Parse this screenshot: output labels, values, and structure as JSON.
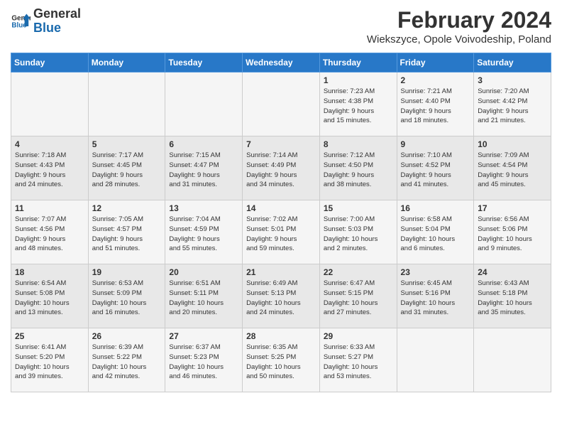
{
  "logo": {
    "general": "General",
    "blue": "Blue"
  },
  "title": "February 2024",
  "subtitle": "Wiekszyce, Opole Voivodeship, Poland",
  "days_of_week": [
    "Sunday",
    "Monday",
    "Tuesday",
    "Wednesday",
    "Thursday",
    "Friday",
    "Saturday"
  ],
  "weeks": [
    [
      {
        "day": "",
        "info": ""
      },
      {
        "day": "",
        "info": ""
      },
      {
        "day": "",
        "info": ""
      },
      {
        "day": "",
        "info": ""
      },
      {
        "day": "1",
        "info": "Sunrise: 7:23 AM\nSunset: 4:38 PM\nDaylight: 9 hours\nand 15 minutes."
      },
      {
        "day": "2",
        "info": "Sunrise: 7:21 AM\nSunset: 4:40 PM\nDaylight: 9 hours\nand 18 minutes."
      },
      {
        "day": "3",
        "info": "Sunrise: 7:20 AM\nSunset: 4:42 PM\nDaylight: 9 hours\nand 21 minutes."
      }
    ],
    [
      {
        "day": "4",
        "info": "Sunrise: 7:18 AM\nSunset: 4:43 PM\nDaylight: 9 hours\nand 24 minutes."
      },
      {
        "day": "5",
        "info": "Sunrise: 7:17 AM\nSunset: 4:45 PM\nDaylight: 9 hours\nand 28 minutes."
      },
      {
        "day": "6",
        "info": "Sunrise: 7:15 AM\nSunset: 4:47 PM\nDaylight: 9 hours\nand 31 minutes."
      },
      {
        "day": "7",
        "info": "Sunrise: 7:14 AM\nSunset: 4:49 PM\nDaylight: 9 hours\nand 34 minutes."
      },
      {
        "day": "8",
        "info": "Sunrise: 7:12 AM\nSunset: 4:50 PM\nDaylight: 9 hours\nand 38 minutes."
      },
      {
        "day": "9",
        "info": "Sunrise: 7:10 AM\nSunset: 4:52 PM\nDaylight: 9 hours\nand 41 minutes."
      },
      {
        "day": "10",
        "info": "Sunrise: 7:09 AM\nSunset: 4:54 PM\nDaylight: 9 hours\nand 45 minutes."
      }
    ],
    [
      {
        "day": "11",
        "info": "Sunrise: 7:07 AM\nSunset: 4:56 PM\nDaylight: 9 hours\nand 48 minutes."
      },
      {
        "day": "12",
        "info": "Sunrise: 7:05 AM\nSunset: 4:57 PM\nDaylight: 9 hours\nand 51 minutes."
      },
      {
        "day": "13",
        "info": "Sunrise: 7:04 AM\nSunset: 4:59 PM\nDaylight: 9 hours\nand 55 minutes."
      },
      {
        "day": "14",
        "info": "Sunrise: 7:02 AM\nSunset: 5:01 PM\nDaylight: 9 hours\nand 59 minutes."
      },
      {
        "day": "15",
        "info": "Sunrise: 7:00 AM\nSunset: 5:03 PM\nDaylight: 10 hours\nand 2 minutes."
      },
      {
        "day": "16",
        "info": "Sunrise: 6:58 AM\nSunset: 5:04 PM\nDaylight: 10 hours\nand 6 minutes."
      },
      {
        "day": "17",
        "info": "Sunrise: 6:56 AM\nSunset: 5:06 PM\nDaylight: 10 hours\nand 9 minutes."
      }
    ],
    [
      {
        "day": "18",
        "info": "Sunrise: 6:54 AM\nSunset: 5:08 PM\nDaylight: 10 hours\nand 13 minutes."
      },
      {
        "day": "19",
        "info": "Sunrise: 6:53 AM\nSunset: 5:09 PM\nDaylight: 10 hours\nand 16 minutes."
      },
      {
        "day": "20",
        "info": "Sunrise: 6:51 AM\nSunset: 5:11 PM\nDaylight: 10 hours\nand 20 minutes."
      },
      {
        "day": "21",
        "info": "Sunrise: 6:49 AM\nSunset: 5:13 PM\nDaylight: 10 hours\nand 24 minutes."
      },
      {
        "day": "22",
        "info": "Sunrise: 6:47 AM\nSunset: 5:15 PM\nDaylight: 10 hours\nand 27 minutes."
      },
      {
        "day": "23",
        "info": "Sunrise: 6:45 AM\nSunset: 5:16 PM\nDaylight: 10 hours\nand 31 minutes."
      },
      {
        "day": "24",
        "info": "Sunrise: 6:43 AM\nSunset: 5:18 PM\nDaylight: 10 hours\nand 35 minutes."
      }
    ],
    [
      {
        "day": "25",
        "info": "Sunrise: 6:41 AM\nSunset: 5:20 PM\nDaylight: 10 hours\nand 39 minutes."
      },
      {
        "day": "26",
        "info": "Sunrise: 6:39 AM\nSunset: 5:22 PM\nDaylight: 10 hours\nand 42 minutes."
      },
      {
        "day": "27",
        "info": "Sunrise: 6:37 AM\nSunset: 5:23 PM\nDaylight: 10 hours\nand 46 minutes."
      },
      {
        "day": "28",
        "info": "Sunrise: 6:35 AM\nSunset: 5:25 PM\nDaylight: 10 hours\nand 50 minutes."
      },
      {
        "day": "29",
        "info": "Sunrise: 6:33 AM\nSunset: 5:27 PM\nDaylight: 10 hours\nand 53 minutes."
      },
      {
        "day": "",
        "info": ""
      },
      {
        "day": "",
        "info": ""
      }
    ]
  ]
}
